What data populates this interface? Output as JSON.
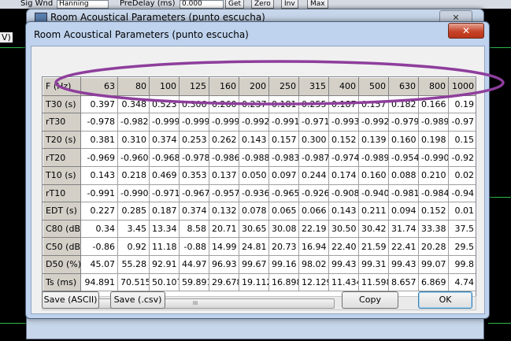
{
  "toolbar": {
    "sig_wnd_label": "Sig Wnd",
    "window_value": "Hanning",
    "predelay_label": "PreDelay (ms)",
    "predelay_value": "0.000",
    "buttons": [
      "Get",
      "Zero",
      "Inv",
      "Max"
    ]
  },
  "background": {
    "ylabel": "V)",
    "back_window_title": "Room Acoustical Parameters (punto escucha)",
    "back_close": "✕"
  },
  "dialog": {
    "title": "Room Acoustical Parameters (punto escucha)",
    "close_label": "✕",
    "header_label": "F (Hz)",
    "frequencies": [
      "63",
      "80",
      "100",
      "125",
      "160",
      "200",
      "250",
      "315",
      "400",
      "500",
      "630",
      "800",
      "1000"
    ],
    "rows": [
      {
        "label": "T30 (s)",
        "values": [
          "0.397",
          "0.348",
          "0.523",
          "0.306",
          "0.260",
          "0.237",
          "0.181",
          "0.255",
          "0.187",
          "0.157",
          "0.182",
          "0.166",
          "0.19"
        ]
      },
      {
        "label": "rT30",
        "values": [
          "-0.978",
          "-0.982",
          "-0.999",
          "-0.999",
          "-0.999",
          "-0.992",
          "-0.991",
          "-0.971",
          "-0.993",
          "-0.992",
          "-0.979",
          "-0.989",
          "-0.97"
        ]
      },
      {
        "label": "T20 (s)",
        "values": [
          "0.381",
          "0.310",
          "0.374",
          "0.253",
          "0.262",
          "0.143",
          "0.157",
          "0.300",
          "0.152",
          "0.139",
          "0.160",
          "0.198",
          "0.15"
        ]
      },
      {
        "label": "rT20",
        "values": [
          "-0.969",
          "-0.960",
          "-0.968",
          "-0.978",
          "-0.986",
          "-0.988",
          "-0.983",
          "-0.987",
          "-0.974",
          "-0.989",
          "-0.954",
          "-0.990",
          "-0.92"
        ]
      },
      {
        "label": "T10 (s)",
        "values": [
          "0.143",
          "0.218",
          "0.469",
          "0.353",
          "0.137",
          "0.050",
          "0.097",
          "0.244",
          "0.174",
          "0.160",
          "0.088",
          "0.210",
          "0.02"
        ]
      },
      {
        "label": "rT10",
        "values": [
          "-0.991",
          "-0.990",
          "-0.971",
          "-0.967",
          "-0.957",
          "-0.936",
          "-0.965",
          "-0.926",
          "-0.908",
          "-0.940",
          "-0.981",
          "-0.984",
          "-0.94"
        ]
      },
      {
        "label": "EDT (s)",
        "values": [
          "0.227",
          "0.285",
          "0.187",
          "0.374",
          "0.132",
          "0.078",
          "0.065",
          "0.066",
          "0.143",
          "0.211",
          "0.094",
          "0.152",
          "0.01"
        ]
      },
      {
        "label": "C80 (dB)",
        "values": [
          "0.34",
          "3.45",
          "13.34",
          "8.58",
          "20.71",
          "30.65",
          "30.08",
          "22.19",
          "30.50",
          "30.42",
          "31.74",
          "33.38",
          "37.5"
        ]
      },
      {
        "label": "C50 (dB)",
        "values": [
          "-0.86",
          "0.92",
          "11.18",
          "-0.88",
          "14.99",
          "24.81",
          "20.73",
          "16.94",
          "22.40",
          "21.59",
          "22.41",
          "20.28",
          "29.5"
        ]
      },
      {
        "label": "D50 (%)",
        "values": [
          "45.07",
          "55.28",
          "92.91",
          "44.97",
          "96.93",
          "99.67",
          "99.16",
          "98.02",
          "99.43",
          "99.31",
          "99.43",
          "99.07",
          "99.8"
        ]
      },
      {
        "label": "Ts (ms)",
        "values": [
          "94.891",
          "70.515",
          "50.107",
          "59.891",
          "29.678",
          "19.112",
          "16.898",
          "12.129",
          "11.434",
          "11.598",
          "8.657",
          "6.869",
          "4.74"
        ]
      }
    ],
    "scroll_thumb_grip": "III",
    "buttons": {
      "save_ascii": "Save (ASCII)",
      "save_csv": "Save (.csv)",
      "copy": "Copy",
      "ok": "OK"
    }
  },
  "colors": {
    "highlight_ellipse": "#8e3e9c",
    "trace_green": "#2fb84a",
    "close_red": "#c7442a"
  }
}
